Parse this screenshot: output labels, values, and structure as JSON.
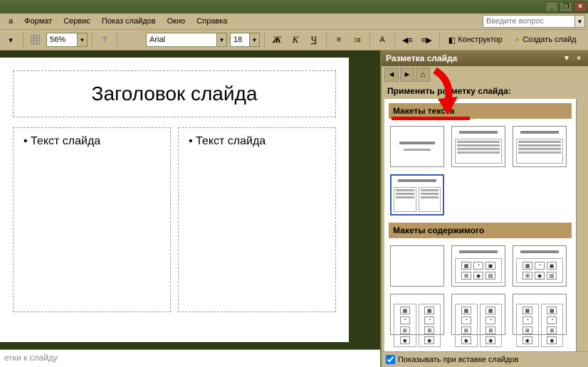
{
  "menu": {
    "items": [
      "а",
      "Формат",
      "Сервис",
      "Показ слайдов",
      "Окно",
      "Справка"
    ],
    "ask_placeholder": "Введите вопрос"
  },
  "toolbar": {
    "zoom": "56%",
    "font_name": "Arial",
    "font_size": "18",
    "bold": "Ж",
    "italic": "К",
    "underline": "Ч",
    "designer": "Конструктор",
    "new_slide": "Создать слайд"
  },
  "slide": {
    "title": "Заголовок слайда",
    "col1": "Текст слайда",
    "col2": "Текст слайда"
  },
  "notes_placeholder": "етки к слайду",
  "taskpane": {
    "title": "Разметка слайда",
    "apply_label": "Применить разметку слайда:",
    "section_text": "Макеты текста",
    "section_content": "Макеты содержимого",
    "show_on_insert": "Показывать при вставке слайдов"
  }
}
